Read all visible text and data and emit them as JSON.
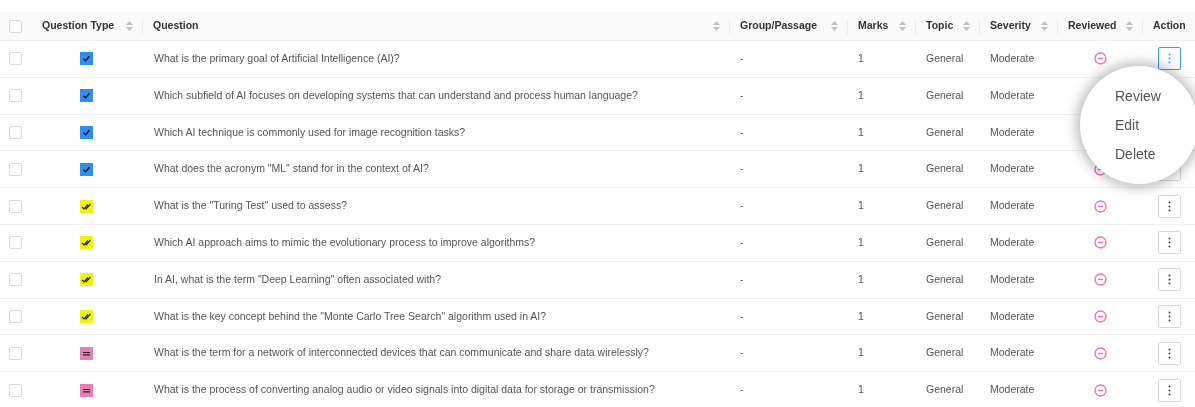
{
  "all_selected": false,
  "columns": [
    "Question Type",
    "Question",
    "Group/Passage",
    "Marks",
    "Topic",
    "Severity",
    "Reviewed",
    "Action"
  ],
  "rows": [
    {
      "selected": false,
      "kind": "single",
      "question": "What is the primary goal of Artificial Intelligence (AI)?",
      "group": "-",
      "marks": "1",
      "topic": "General",
      "severity": "Moderate",
      "reviewed": false,
      "menu_open": true
    },
    {
      "selected": false,
      "kind": "single",
      "question": "Which subfield of AI focuses on developing systems that can understand and process human language?",
      "group": "-",
      "marks": "1",
      "topic": "General",
      "severity": "Moderate"
    },
    {
      "selected": false,
      "kind": "single",
      "question": "Which AI technique is commonly used for image recognition tasks?",
      "group": "-",
      "marks": "1",
      "topic": "General",
      "severity": "Moderate"
    },
    {
      "selected": false,
      "kind": "single",
      "question": "What does the acronym \"ML\" stand for in the context of AI?",
      "group": "-",
      "marks": "1",
      "topic": "General",
      "severity": "Moderate",
      "reviewed": false,
      "menu_open": false
    },
    {
      "selected": false,
      "kind": "multiple",
      "question": "What is the \"Turing Test\" used to assess?",
      "group": "-",
      "marks": "1",
      "topic": "General",
      "severity": "Moderate",
      "reviewed": false,
      "menu_open": false
    },
    {
      "selected": false,
      "kind": "multiple",
      "question": "Which AI approach aims to mimic the evolutionary process to improve algorithms?",
      "group": "-",
      "marks": "1",
      "topic": "General",
      "severity": "Moderate",
      "reviewed": false,
      "menu_open": false
    },
    {
      "selected": false,
      "kind": "multiple",
      "question": "In AI, what is the term \"Deep Learning\" often associated with?",
      "group": "-",
      "marks": "1",
      "topic": "General",
      "severity": "Moderate",
      "reviewed": false,
      "menu_open": false
    },
    {
      "selected": false,
      "kind": "multiple",
      "question": "What is the key concept behind the \"Monte Carlo Tree Search\" algorithm used in AI?",
      "group": "-",
      "marks": "1",
      "topic": "General",
      "severity": "Moderate",
      "reviewed": false,
      "menu_open": false
    },
    {
      "selected": false,
      "kind": "blank",
      "question": "What is the term for a network of interconnected devices that can communicate and share data wirelessly?",
      "group": "-",
      "marks": "1",
      "topic": "General",
      "severity": "Moderate",
      "reviewed": false,
      "menu_open": false
    },
    {
      "selected": false,
      "kind": "blank",
      "question": "What is the process of converting analog audio or video signals into digital data for storage or transmission?",
      "group": "-",
      "marks": "1",
      "topic": "General",
      "severity": "Moderate",
      "reviewed": false,
      "menu_open": false
    }
  ],
  "menu": [
    "Review",
    "Edit",
    "Delete"
  ]
}
